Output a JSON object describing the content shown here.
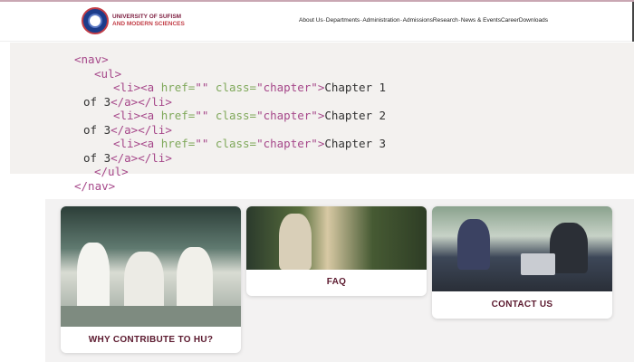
{
  "header": {
    "logo_line1": "UNIVERSITY OF SUFISM",
    "logo_line2": "AND MODERN SCIENCES",
    "nav": [
      "About Us",
      "Departments",
      "Administration",
      "Admissions",
      "Research",
      "News & Events",
      "Career",
      "Downloads"
    ],
    "nav_sep": "-"
  },
  "code": {
    "nav_open": "<nav>",
    "ul_open": "<ul>",
    "li_open": "<li>",
    "a_open": "<a ",
    "href_attr": "href=",
    "href_val": "\"\"",
    "class_attr": "class=",
    "class_val": "\"chapter\"",
    "gt": ">",
    "items": [
      "Chapter 1",
      "Chapter 2",
      "Chapter 3"
    ],
    "of_text": "of 3",
    "a_close": "</a>",
    "li_close": "</li>",
    "ul_close": "</ul>",
    "nav_close": "</nav>"
  },
  "cards": [
    {
      "label": "WHY CONTRIBUTE TO HU?"
    },
    {
      "label": "FAQ"
    },
    {
      "label": "CONTACT US"
    }
  ],
  "colors": {
    "brand": "#7d1d3f",
    "tag": "#a6488a",
    "attr": "#7fa85a"
  }
}
